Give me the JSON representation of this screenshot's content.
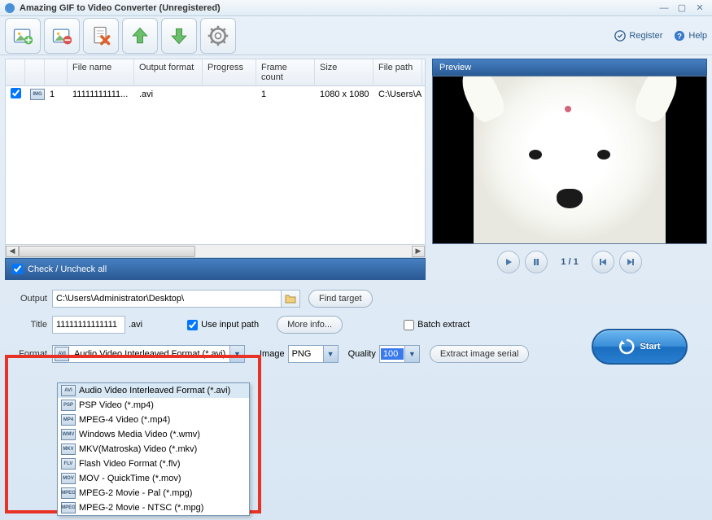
{
  "window": {
    "title": "Amazing GIF to Video Converter (Unregistered)"
  },
  "links": {
    "register": "Register",
    "help": "Help"
  },
  "table": {
    "headers": {
      "filename": "File name",
      "output_format": "Output format",
      "progress": "Progress",
      "frame_count": "Frame count",
      "size": "Size",
      "file_path": "File path"
    },
    "rows": [
      {
        "index": "1",
        "filename": "11111111111...",
        "output_format": ".avi",
        "progress": "",
        "frame_count": "1",
        "size": "1080 x 1080",
        "file_path": "C:\\Users\\A",
        "checked": true
      }
    ],
    "check_all_label": "Check / Uncheck all"
  },
  "preview": {
    "title": "Preview",
    "counter": "1 / 1"
  },
  "form": {
    "output_label": "Output",
    "output_value": "C:\\Users\\Administrator\\Desktop\\",
    "title_label": "Title",
    "title_value": "11111111111111",
    "title_ext": ".avi",
    "use_input_path_label": "Use input path",
    "find_target": "Find target",
    "more_info": "More info...",
    "batch_extract": "Batch extract",
    "format_label": "Format",
    "format_selected": "Audio Video Interleaved Format (*.avi)",
    "image_label": "Image",
    "image_value": "PNG",
    "quality_label": "Quality",
    "quality_value": "100",
    "extract_serial": "Extract image serial",
    "start": "Start"
  },
  "format_options": [
    {
      "tag": "AVI",
      "label": "Audio Video Interleaved Format (*.avi)"
    },
    {
      "tag": "PSP",
      "label": "PSP Video (*.mp4)"
    },
    {
      "tag": "MP4",
      "label": "MPEG-4 Video (*.mp4)"
    },
    {
      "tag": "WMV",
      "label": "Windows Media Video (*.wmv)"
    },
    {
      "tag": "MKV",
      "label": "MKV(Matroska) Video (*.mkv)"
    },
    {
      "tag": "FLV",
      "label": "Flash Video Format (*.flv)"
    },
    {
      "tag": "MOV",
      "label": "MOV - QuickTime (*.mov)"
    },
    {
      "tag": "MPEG",
      "label": "MPEG-2 Movie - Pal (*.mpg)"
    },
    {
      "tag": "MPEG",
      "label": "MPEG-2 Movie - NTSC (*.mpg)"
    }
  ]
}
